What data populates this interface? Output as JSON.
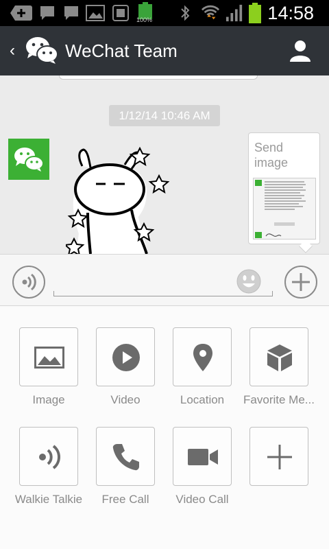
{
  "status_bar": {
    "time": "14:58",
    "battery_small_label": "100%",
    "icons": [
      "add-notification-icon",
      "sms-icon",
      "sms-icon",
      "gallery-icon",
      "screenshot-icon",
      "battery-full-icon",
      "bluetooth-icon",
      "wifi-icon",
      "signal-icon",
      "battery-icon"
    ]
  },
  "header": {
    "title": "WeChat Team",
    "back_icon": "chevron-left-icon",
    "logo_icon": "wechat-logo-icon",
    "profile_icon": "person-icon"
  },
  "chat": {
    "timestamp": "1/12/14 10:46 AM",
    "card_label": "Send image",
    "accent_color": "#3cb034"
  },
  "input_bar": {
    "text_value": "",
    "voice_icon": "voice-icon",
    "emoji_icon": "smiley-icon",
    "plus_icon": "plus-icon"
  },
  "attachments": [
    {
      "label": "Image",
      "icon": "image-icon"
    },
    {
      "label": "Video",
      "icon": "play-icon"
    },
    {
      "label": "Location",
      "icon": "location-pin-icon"
    },
    {
      "label": "Favorite Me...",
      "icon": "cube-icon"
    },
    {
      "label": "Walkie Talkie",
      "icon": "walkie-talkie-icon"
    },
    {
      "label": "Free Call",
      "icon": "phone-icon"
    },
    {
      "label": "Video Call",
      "icon": "video-camera-icon"
    },
    {
      "label": "",
      "icon": "plus-icon"
    }
  ]
}
